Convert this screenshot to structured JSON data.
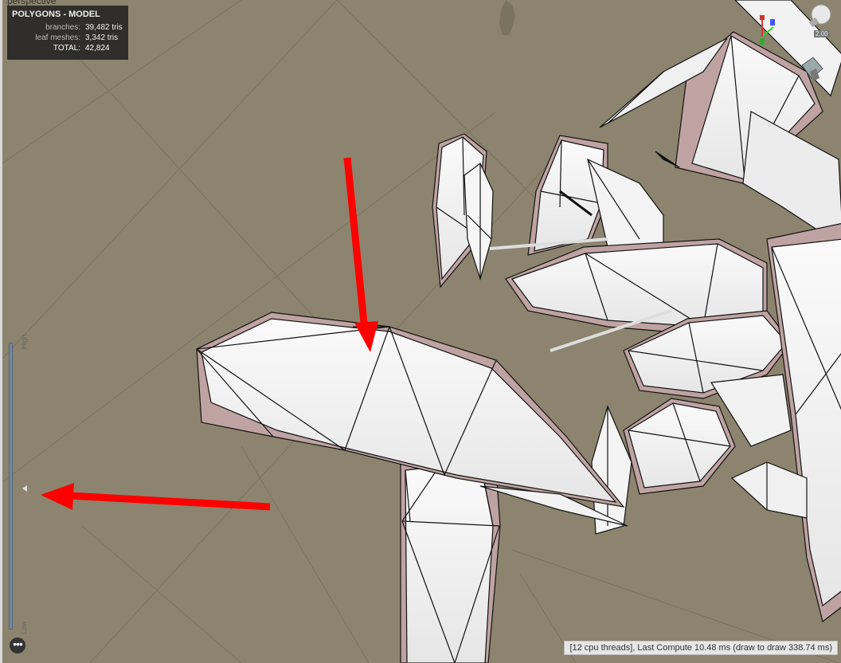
{
  "viewport": {
    "title": "perspective"
  },
  "stats": {
    "header": "POLYGONS - MODEL",
    "rows": [
      {
        "label": "branches:",
        "value": "39,482 tris"
      },
      {
        "label": "leaf meshes:",
        "value": "3,342 tris"
      },
      {
        "label": "TOTAL:",
        "value": "42,824"
      }
    ]
  },
  "lod_slider": {
    "high_label": "High",
    "low_label": "Low",
    "level": 0.52
  },
  "zoom_label": "2.00",
  "more_button": {
    "label": "•••"
  },
  "status_bar": {
    "text": "[12 cpu threads], Last Compute 10.48 ms (draw to draw 338.74 ms)"
  },
  "colors": {
    "background": "#8c846e",
    "leaf_fill": "#f2f2f2",
    "leaf_edge": "#bfa3a3",
    "arrow": "#ff0000"
  },
  "icons": [
    "axis-gizmo-icon",
    "light-bulb-icon",
    "light-fixture-icon",
    "ellipsis-icon"
  ]
}
